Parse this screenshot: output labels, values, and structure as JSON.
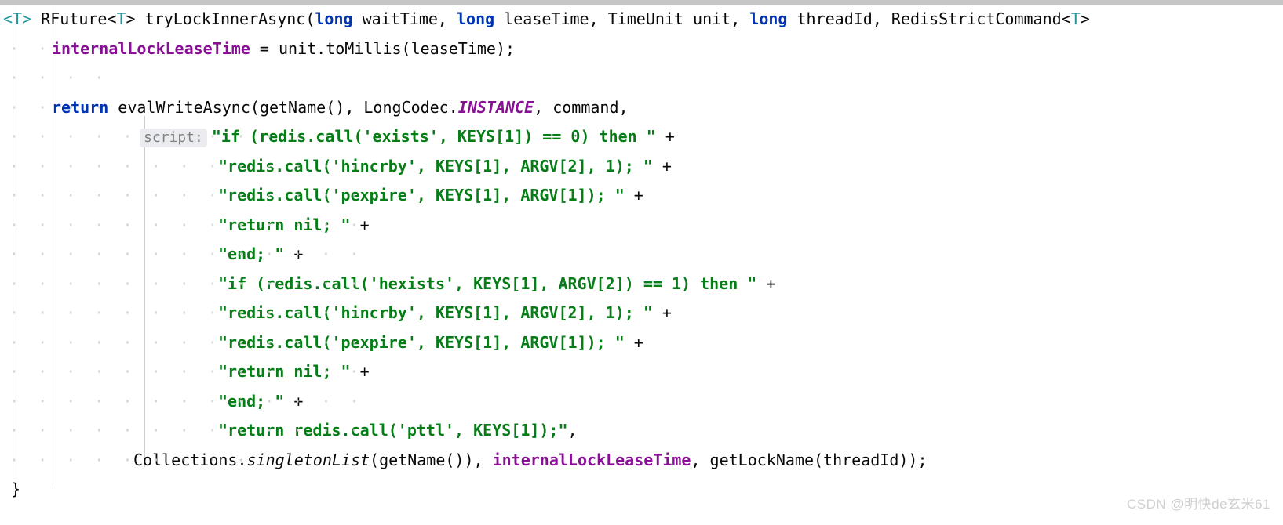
{
  "editor": {
    "language": "Java",
    "theme": "IntelliJ Light",
    "colors": {
      "background": "#ffffff",
      "text": "#080808",
      "keyword": "#0033b3",
      "string": "#067d17",
      "field": "#871094",
      "type_parameter": "#20999d",
      "indent_guide": "#cdcdcd",
      "hint_background": "#ebecf0",
      "hint_text": "#808080",
      "top_strip": "#c6c6c6",
      "watermark": "#cfcfcf"
    }
  },
  "hints": {
    "script_param": "script:"
  },
  "code": {
    "line1": {
      "generic_open": "<T>",
      "space1": " ",
      "rfuture": "RFuture<",
      "generic_t": "T",
      "gt": "> ",
      "method": "tryLockInnerAsync(",
      "kw_long1": "long",
      "p_waitTime": " waitTime, ",
      "kw_long2": "long",
      "p_leaseTime": " leaseTime, TimeUnit unit, ",
      "kw_long3": "long",
      "p_threadId": " threadId, RedisStrictCommand<",
      "generic_t2": "T",
      "tail": ">"
    },
    "line2": {
      "field": "internalLockLeaseTime",
      "rest": " = unit.toMillis(leaseTime);"
    },
    "line4": {
      "kw_return": "return",
      "call": " evalWriteAsync(getName(), LongCodec.",
      "instance": "INSTANCE",
      "tail": ", command,"
    },
    "line5": {
      "string": "\"if (redis.call('exists', KEYS[1]) == 0) then \"",
      "plus": " +"
    },
    "line6": {
      "string": "\"redis.call('hincrby', KEYS[1], ARGV[2], 1); \"",
      "plus": " +"
    },
    "line7": {
      "string": "\"redis.call('pexpire', KEYS[1], ARGV[1]); \"",
      "plus": " +"
    },
    "line8": {
      "string": "\"return nil; \"",
      "plus": " +"
    },
    "line9": {
      "string": "\"end; \"",
      "plus": " +"
    },
    "line10": {
      "string": "\"if (redis.call('hexists', KEYS[1], ARGV[2]) == 1) then \"",
      "plus": " +"
    },
    "line11": {
      "string": "\"redis.call('hincrby', KEYS[1], ARGV[2], 1); \"",
      "plus": " +"
    },
    "line12": {
      "string": "\"redis.call('pexpire', KEYS[1], ARGV[1]); \"",
      "plus": " +"
    },
    "line13": {
      "string": "\"return nil; \"",
      "plus": " +"
    },
    "line14": {
      "string": "\"end; \"",
      "plus": " +"
    },
    "line15": {
      "string": "\"return redis.call('pttl', KEYS[1]);\"",
      "comma": ","
    },
    "line16": {
      "prefix": "Collections.",
      "static_method": "singletonList",
      "mid": "(getName()), ",
      "field": "internalLockLeaseTime",
      "tail": ", getLockName(threadId));"
    },
    "line17": {
      "brace": "}"
    }
  },
  "watermark": {
    "text": "CSDN @明快de玄米61"
  }
}
